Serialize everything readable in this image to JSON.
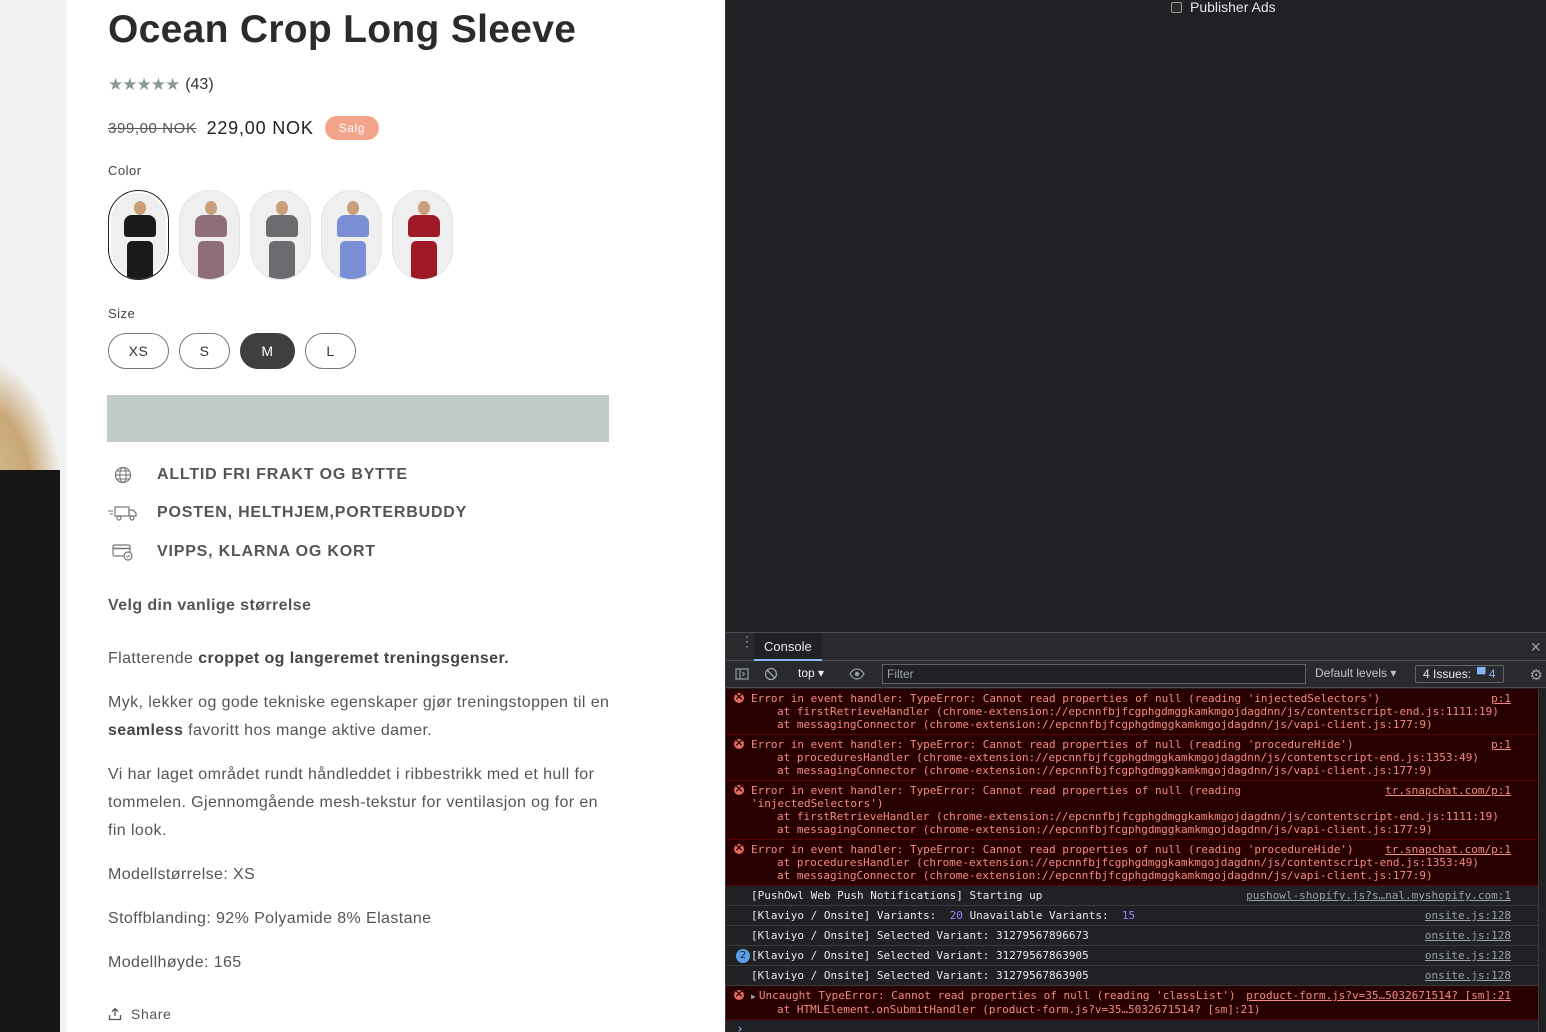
{
  "product": {
    "title": "Ocean Crop Long Sleeve",
    "rating": {
      "stars": "★★★★★",
      "count": "(43)",
      "value": 5
    },
    "price": {
      "old": "399,00 NOK",
      "new": "229,00 NOK",
      "badge": "Salg"
    },
    "color_label": "Color",
    "colors": [
      {
        "name": "black",
        "hex": "#1a1a1a",
        "selected": true
      },
      {
        "name": "mauve",
        "hex": "#8e6f78",
        "selected": false
      },
      {
        "name": "grey",
        "hex": "#6c6c70",
        "selected": false
      },
      {
        "name": "blue",
        "hex": "#7b8fd6",
        "selected": false
      },
      {
        "name": "red",
        "hex": "#9e1a26",
        "selected": false
      }
    ],
    "size_label": "Size",
    "sizes": [
      {
        "label": "XS",
        "active": false
      },
      {
        "label": "S",
        "active": false
      },
      {
        "label": "M",
        "active": true
      },
      {
        "label": "L",
        "active": false
      }
    ],
    "features": [
      {
        "icon": "globe-icon",
        "text": "ALLTID FRI FRAKT OG BYTTE"
      },
      {
        "icon": "truck-icon",
        "text": "POSTEN, HELTHJEM,PORTERBUDDY"
      },
      {
        "icon": "card-icon",
        "text": "VIPPS, KLARNA OG KORT"
      }
    ],
    "size_hint": "Velg din vanlige størrelse",
    "description": {
      "p1_plain": "Flatterende ",
      "p1_bold": "croppet og langeremet treningsgenser.",
      "p2_a": "Myk, lekker og gode tekniske egenskaper gjør treningstoppen til en ",
      "p2_bold": "seamless",
      "p2_b": " favoritt hos mange aktive damer.",
      "p3": "Vi har laget området rundt håndleddet i ribbestrikk med et hull for tommelen. Gjennomgående mesh-tekstur for ventilasjon og for en fin look.",
      "model_size": "Modellstørrelse: XS",
      "fabric": "Stoffblanding: 92% Polyamide 8% Elastane",
      "model_height": "Modellhøyde: 165"
    },
    "share_label": "Share"
  },
  "devtools": {
    "publisher_ads": "Publisher Ads",
    "tab": "Console",
    "context": "top ▾",
    "filter_placeholder": "Filter",
    "levels": "Default levels ▾",
    "issues_label": "4 Issues:",
    "issues_count": "▀ 4",
    "messages": [
      {
        "type": "error",
        "text": "Error in event handler: TypeError: Cannot read properties of null (reading 'injectedSelectors')",
        "source": "p:1",
        "stack": [
          "at firstRetrieveHandler (chrome-extension://epcnnfbjfcgphgdmggkamkmgojdagdnn/js/contentscript-end.js:1111:19)",
          "at messagingConnector (chrome-extension://epcnnfbjfcgphgdmggkamkmgojdagdnn/js/vapi-client.js:177:9)"
        ]
      },
      {
        "type": "error",
        "text": "Error in event handler: TypeError: Cannot read properties of null (reading 'procedureHide')",
        "source": "p:1",
        "stack": [
          "at proceduresHandler (chrome-extension://epcnnfbjfcgphgdmggkamkmgojdagdnn/js/contentscript-end.js:1353:49)",
          "at messagingConnector (chrome-extension://epcnnfbjfcgphgdmggkamkmgojdagdnn/js/vapi-client.js:177:9)"
        ]
      },
      {
        "type": "error",
        "text": "Error in event handler: TypeError: Cannot read properties of null (reading",
        "text2": "'injectedSelectors')",
        "source": "tr.snapchat.com/p:1",
        "stack": [
          "at firstRetrieveHandler (chrome-extension://epcnnfbjfcgphgdmggkamkmgojdagdnn/js/contentscript-end.js:1111:19)",
          "at messagingConnector (chrome-extension://epcnnfbjfcgphgdmggkamkmgojdagdnn/js/vapi-client.js:177:9)"
        ]
      },
      {
        "type": "error",
        "text": "Error in event handler: TypeError: Cannot read properties of null (reading 'procedureHide')",
        "source": "tr.snapchat.com/p:1",
        "stack": [
          "at proceduresHandler (chrome-extension://epcnnfbjfcgphgdmggkamkmgojdagdnn/js/contentscript-end.js:1353:49)",
          "at messagingConnector (chrome-extension://epcnnfbjfcgphgdmggkamkmgojdagdnn/js/vapi-client.js:177:9)"
        ]
      },
      {
        "type": "log",
        "text": "[PushOwl Web Push Notifications] Starting up",
        "source": "pushowl-shopify.js?s…nal.myshopify.com:1"
      },
      {
        "type": "log-variants",
        "text_a": "[Klaviyo / Onsite] Variants:",
        "n1": "20",
        "text_b": "Unavailable Variants:",
        "n2": "15",
        "source": "onsite.js:128"
      },
      {
        "type": "log",
        "text": "[Klaviyo / Onsite] Selected Variant: 31279567896673",
        "source": "onsite.js:128"
      },
      {
        "type": "log-count",
        "count": "2",
        "text": "[Klaviyo / Onsite] Selected Variant: 31279567863905",
        "source": "onsite.js:128"
      },
      {
        "type": "log",
        "text": "[Klaviyo / Onsite] Selected Variant: 31279567863905",
        "source": "onsite.js:128"
      },
      {
        "type": "uncaught",
        "text": "Uncaught TypeError: Cannot read properties of null (reading 'classList')",
        "source": "product-form.js?v=35…5032671514? [sm]:21",
        "stack": [
          "at HTMLElement.onSubmitHandler (product-form.js?v=35…5032671514? [sm]:21)"
        ]
      }
    ],
    "prompt": "›"
  }
}
